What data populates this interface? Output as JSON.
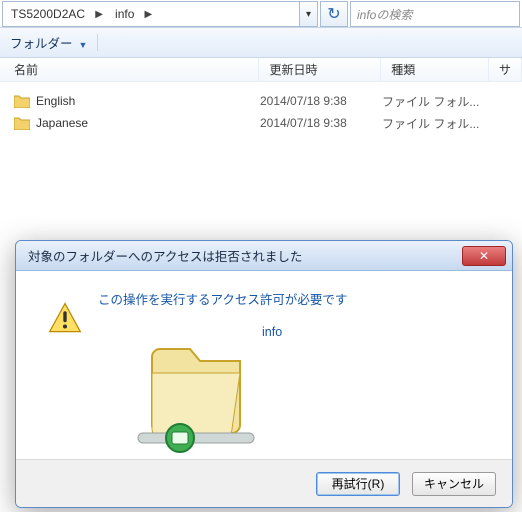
{
  "addressbar": {
    "segments": [
      "TS5200D2AC",
      "info"
    ],
    "dropdown_glyph": "▾",
    "chevron_glyph": "▶",
    "refresh_glyph": "↻"
  },
  "search": {
    "placeholder": "infoの検索"
  },
  "toolbar": {
    "new_folder_label": "フォルダー",
    "arrow_glyph": "▼"
  },
  "columns": {
    "name": "名前",
    "date": "更新日時",
    "type": "種類",
    "size": "サ"
  },
  "rows": [
    {
      "name": "English",
      "date": "2014/07/18 9:38",
      "type": "ファイル フォル..."
    },
    {
      "name": "Japanese",
      "date": "2014/07/18 9:38",
      "type": "ファイル フォル..."
    }
  ],
  "dialog": {
    "title": "対象のフォルダーへのアクセスは拒否されました",
    "message": "この操作を実行するアクセス許可が必要です",
    "subject": "info",
    "retry_label": "再試行(R)",
    "cancel_label": "キャンセル",
    "close_glyph": "✕"
  }
}
